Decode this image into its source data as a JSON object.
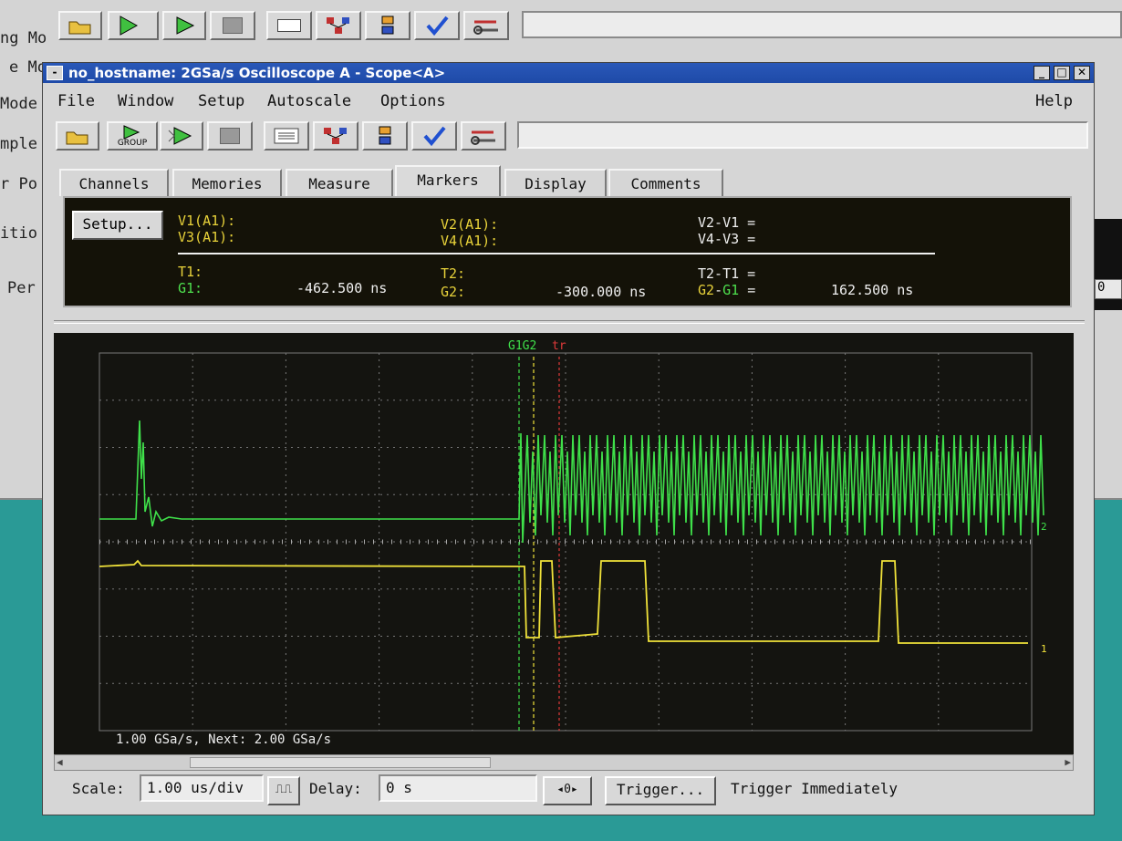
{
  "background_window": {
    "side_labels": [
      "ng Mo",
      "e Moc",
      "Mode",
      "mple",
      "r Po",
      "itio",
      "Per"
    ]
  },
  "window": {
    "title": "no_hostname: 2GSa/s Oscilloscope A - Scope<A>",
    "controls": {
      "minimize": "_",
      "maximize": "□",
      "close": "✕"
    }
  },
  "menu": {
    "file": "File",
    "window": "Window",
    "setup": "Setup",
    "autoscale": "Autoscale",
    "options": "Options",
    "help": "Help"
  },
  "toolbar": {
    "group_label": "GROUP",
    "icons": [
      "open-folder-icon",
      "run-group-icon",
      "run-icon",
      "stop-icon",
      "list-icon",
      "network-icon",
      "tree-icon",
      "checkmark-icon",
      "tools-icon"
    ]
  },
  "tabs": [
    "Channels",
    "Memories",
    "Measure",
    "Markers",
    "Display",
    "Comments"
  ],
  "markers": {
    "setup_button": "Setup...",
    "v1": "V1(A1):",
    "v3": "V3(A1):",
    "v2": "V2(A1):",
    "v4": "V4(A1):",
    "v2v1": "V2-V1 =",
    "v4v3": "V4-V3 =",
    "t1": "T1:",
    "g1": "G1:",
    "g1_value": "-462.500 ns",
    "t2": "T2:",
    "g2": "G2:",
    "g2_value": "-300.000 ns",
    "t2t1": "T2-T1 =",
    "g2g1_a": "G2",
    "g2g1_dash": "-",
    "g2g1_b": "G1",
    "g2g1_eq": "=",
    "g2g1_value": "162.500 ns"
  },
  "scope": {
    "marker_label_g1g2": "G1G2",
    "marker_label_trigger": "tr",
    "sample_rate_text": "1.00 GSa/s, Next: 2.00 GSa/s",
    "channel_marker_green": "2",
    "channel_marker_yellow": "1",
    "colors": {
      "grid": "#777777",
      "green": "#3fe04a",
      "yellow": "#f0e23a",
      "trigger": "#e03a3a"
    }
  },
  "bottom": {
    "scale_label": "Scale:",
    "scale_value": "1.00 us/div",
    "delay_label": "Delay:",
    "delay_value": "0 s",
    "stepper_value": "0",
    "trigger_button": "Trigger...",
    "trigger_status": "Trigger Immediately"
  }
}
